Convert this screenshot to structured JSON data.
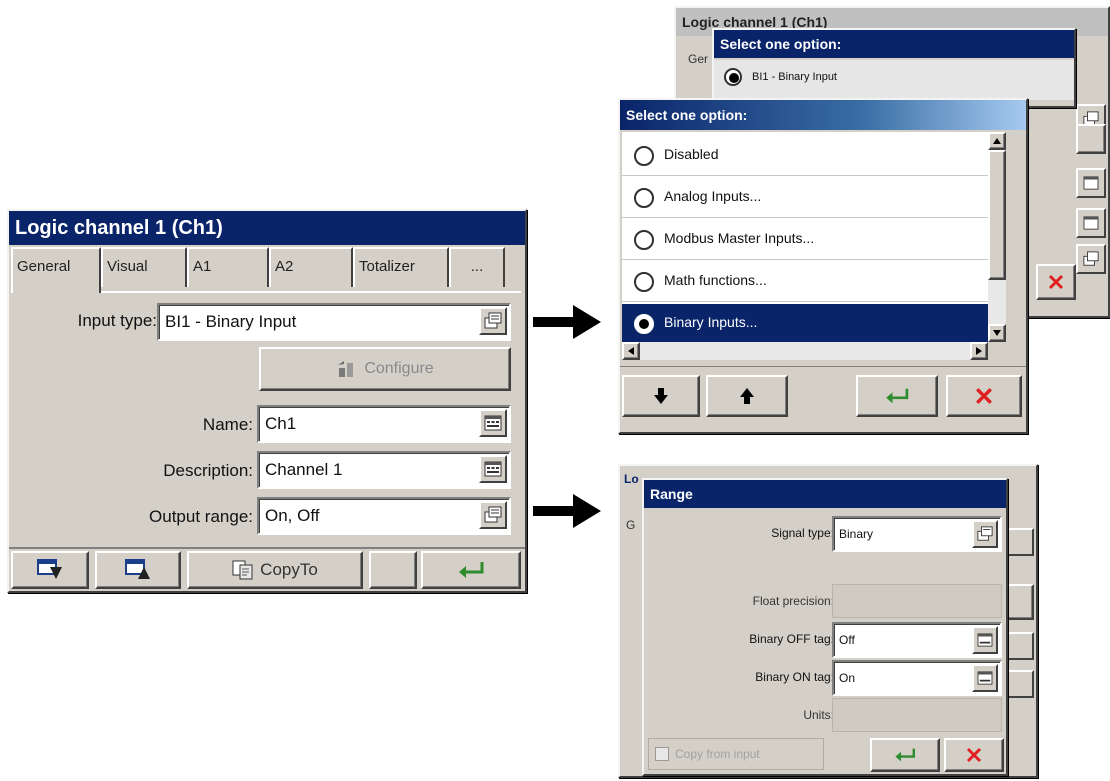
{
  "main_window": {
    "title": "Logic channel 1 (Ch1)",
    "tabs": [
      "General",
      "Visual",
      "A1",
      "A2",
      "Totalizer",
      "..."
    ],
    "input_type_label": "Input type:",
    "input_type_value": "BI1 - Binary Input",
    "configure_label": "Configure",
    "name_label": "Name:",
    "name_value": "Ch1",
    "description_label": "Description:",
    "description_value": "Channel 1",
    "output_range_label": "Output range:",
    "output_range_value": "On, Off",
    "copyto_label": "CopyTo"
  },
  "back_window": {
    "title": "Logic channel 1 (Ch1)",
    "tab_partial": "Ger"
  },
  "select_popup_small": {
    "title": "Select one option:",
    "selected_option": "BI1 - Binary Input"
  },
  "select_popup": {
    "title": "Select one option:",
    "options": [
      {
        "label": "Disabled",
        "selected": false
      },
      {
        "label": "Analog Inputs...",
        "selected": false
      },
      {
        "label": "Modbus Master Inputs...",
        "selected": false
      },
      {
        "label": "Math functions...",
        "selected": false
      },
      {
        "label": "Binary Inputs...",
        "selected": true
      }
    ]
  },
  "range_dialog": {
    "behind_label": "Lo",
    "behind_tab": "G",
    "title": "Range",
    "signal_type_label": "Signal type:",
    "signal_type_value": "Binary",
    "float_precision_label": "Float precision:",
    "binary_off_label": "Binary OFF tag:",
    "binary_off_value": "Off",
    "binary_on_label": "Binary ON tag:",
    "binary_on_value": "On",
    "units_label": "Units:",
    "copy_from_input_label": "Copy from input"
  },
  "colors": {
    "titlebar": "#0a246a",
    "face": "#d4d0c8",
    "enter_green": "#2e8b2e",
    "cancel_red": "#e02020"
  }
}
